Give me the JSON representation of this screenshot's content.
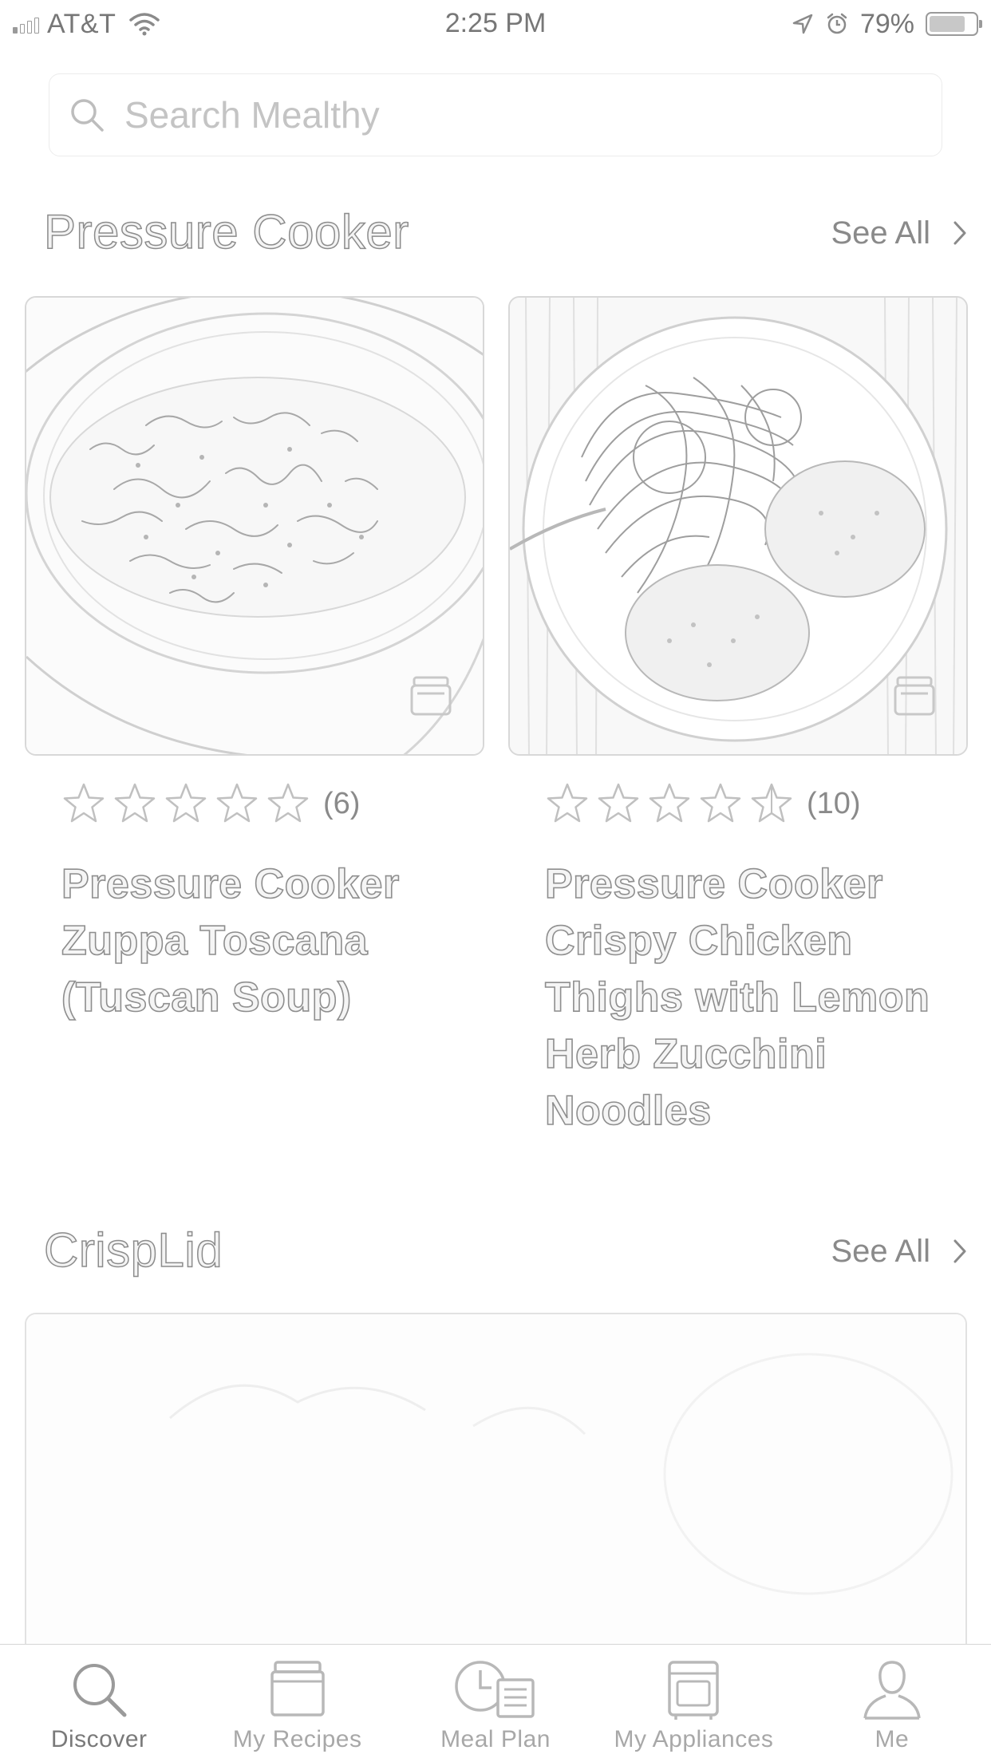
{
  "status_bar": {
    "carrier": "AT&T",
    "time": "2:25 PM",
    "battery_percent": "79%",
    "battery_level": 0.79
  },
  "search": {
    "placeholder": "Search Mealthy"
  },
  "sections": [
    {
      "title": "Pressure Cooker",
      "see_all_label": "See All",
      "recipes": [
        {
          "rating": 5,
          "rating_count": "(6)",
          "title": "Pressure Cooker Zuppa Toscana (Tuscan Soup)",
          "icon": "basket-icon"
        },
        {
          "rating": 4.5,
          "rating_count": "(10)",
          "title": "Pressure Cooker Crispy Chicken Thighs with Lemon Herb Zucchini Noodles",
          "icon": "basket-icon"
        }
      ]
    },
    {
      "title": "CrispLid",
      "see_all_label": "See All"
    }
  ],
  "tab_bar": {
    "active": "Discover",
    "tabs": [
      {
        "label": "Discover",
        "icon": "search-icon"
      },
      {
        "label": "My Recipes",
        "icon": "recipe-box-icon"
      },
      {
        "label": "Meal Plan",
        "icon": "clock-list-icon"
      },
      {
        "label": "My Appliances",
        "icon": "appliance-icon"
      },
      {
        "label": "Me",
        "icon": "person-icon"
      }
    ]
  },
  "colors": {
    "text": "#8a8a8a",
    "border": "#d8d8d8",
    "background": "#ffffff"
  }
}
